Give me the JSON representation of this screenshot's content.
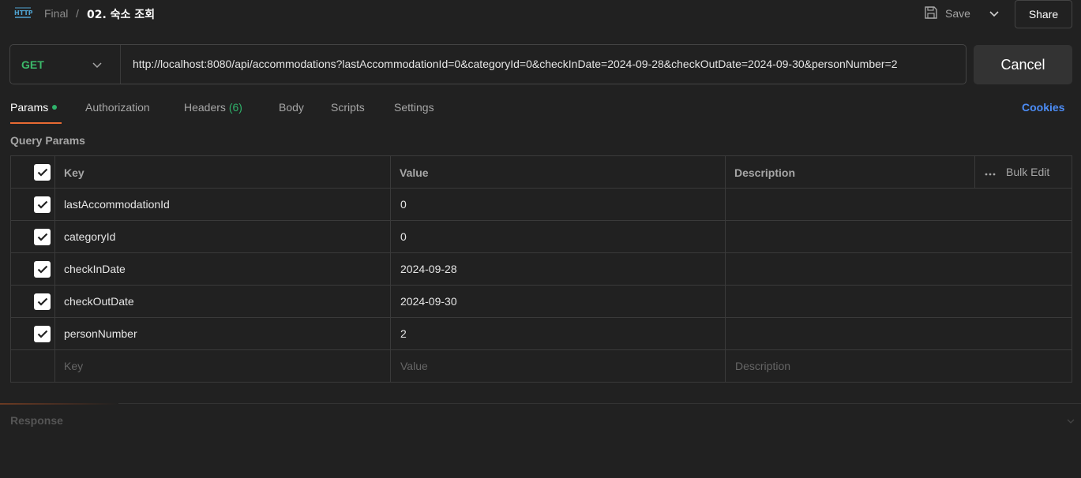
{
  "header": {
    "icon": "http-icon",
    "breadcrumb_parent": "Final",
    "breadcrumb_sep": "/",
    "title": "02. 숙소 조회",
    "save_label": "Save",
    "share_label": "Share"
  },
  "request": {
    "method": "GET",
    "url": "http://localhost:8080/api/accommodations?lastAccommodationId=0&categoryId=0&checkInDate=2024-09-28&checkOutDate=2024-09-30&personNumber=2",
    "cancel_label": "Cancel"
  },
  "tabs": [
    {
      "label": "Params",
      "active": true,
      "dot": true
    },
    {
      "label": "Authorization"
    },
    {
      "label": "Headers",
      "count": "(6)"
    },
    {
      "label": "Body"
    },
    {
      "label": "Scripts"
    },
    {
      "label": "Settings"
    }
  ],
  "cookies_label": "Cookies",
  "query_params_label": "Query Params",
  "table": {
    "headers": {
      "key": "Key",
      "value": "Value",
      "description": "Description",
      "bulk_edit": "Bulk Edit"
    },
    "rows": [
      {
        "key": "lastAccommodationId",
        "value": "0",
        "checked": true
      },
      {
        "key": "categoryId",
        "value": "0",
        "checked": true
      },
      {
        "key": "checkInDate",
        "value": "2024-09-28",
        "checked": true
      },
      {
        "key": "checkOutDate",
        "value": "2024-09-30",
        "checked": true
      },
      {
        "key": "personNumber",
        "value": "2",
        "checked": true
      }
    ],
    "placeholders": {
      "key": "Key",
      "value": "Value",
      "description": "Description"
    }
  },
  "response_label": "Response",
  "colors": {
    "background": "#212121",
    "method_get": "#3cba6a",
    "accent_orange": "#e86a33",
    "link_blue": "#4c8cf5",
    "active_dot_green": "#2fb36b"
  }
}
